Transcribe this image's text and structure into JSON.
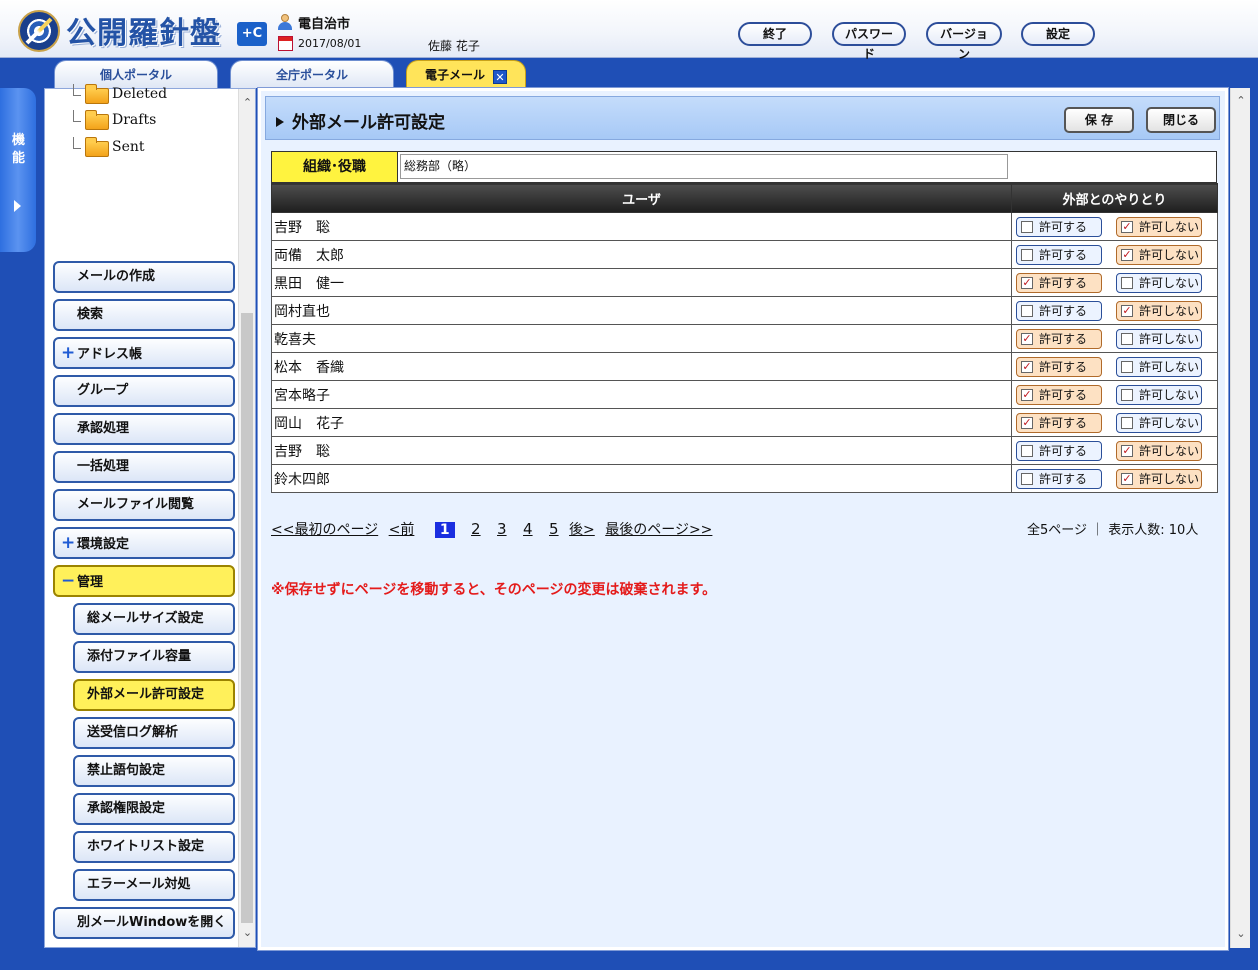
{
  "header": {
    "app_name": "公開羅針盤",
    "badge": "+C",
    "org": "電自治市",
    "date": "2017/08/01",
    "user": "佐藤 花子",
    "buttons": {
      "exit": "終了",
      "password": "パスワード",
      "version": "バージョン",
      "settings": "設定"
    }
  },
  "tabs": [
    {
      "label": "個人ポータル"
    },
    {
      "label": "全庁ポータル"
    },
    {
      "label": "電子メール",
      "close": "✕"
    }
  ],
  "func_strip": {
    "label": "機能"
  },
  "sidebar": {
    "folders": [
      "Deleted",
      "Drafts",
      "Sent"
    ],
    "nav": {
      "compose": "メールの作成",
      "search": "検索",
      "address_book": "アドレス帳",
      "group": "グループ",
      "approval": "承認処理",
      "bulk": "一括処理",
      "mail_file": "メールファイル閲覧",
      "env_settings": "環境設定",
      "admin": "管理",
      "open_window": "別メールWindowを開く"
    },
    "admin_items": [
      "総メールサイズ設定",
      "添付ファイル容量",
      "外部メール許可設定",
      "送受信ログ解析",
      "禁止語句設定",
      "承認権限設定",
      "ホワイトリスト設定",
      "エラーメール対処"
    ]
  },
  "main": {
    "title": "外部メール許可設定",
    "save": "保 存",
    "close": "閉じる",
    "org_label": "組織･役職",
    "org_value": "総務部（略）",
    "col_user": "ユーザ",
    "col_external": "外部とのやりとり",
    "allow_label": "許可する",
    "deny_label": "許可しない",
    "users": [
      {
        "name": "吉野　聡",
        "allow": false
      },
      {
        "name": "両備　太郎",
        "allow": false
      },
      {
        "name": "黒田　健一",
        "allow": true
      },
      {
        "name": "岡村直也",
        "allow": false
      },
      {
        "name": "乾喜夫",
        "allow": true
      },
      {
        "name": "松本　香織",
        "allow": true
      },
      {
        "name": "宮本略子",
        "allow": true
      },
      {
        "name": "岡山　花子",
        "allow": true
      },
      {
        "name": "吉野　聡",
        "allow": false
      },
      {
        "name": "鈴木四郎",
        "allow": false
      }
    ],
    "pager": {
      "first": "<<最初のページ",
      "prev": "<前",
      "pages": [
        "1",
        "2",
        "3",
        "4",
        "5"
      ],
      "current": "1",
      "next": "後>",
      "last": "最後のページ>>"
    },
    "page_info": "全5ページ ｜ 表示人数: 10人",
    "warning": "※保存せずにページを移動すると、そのページの変更は破棄されます。"
  },
  "colors": {
    "frame_blue": "#1f4fb6",
    "active_yellow": "#fff05a",
    "panel_bg": "#e9f2ff",
    "warning_red": "#e41b1b"
  }
}
